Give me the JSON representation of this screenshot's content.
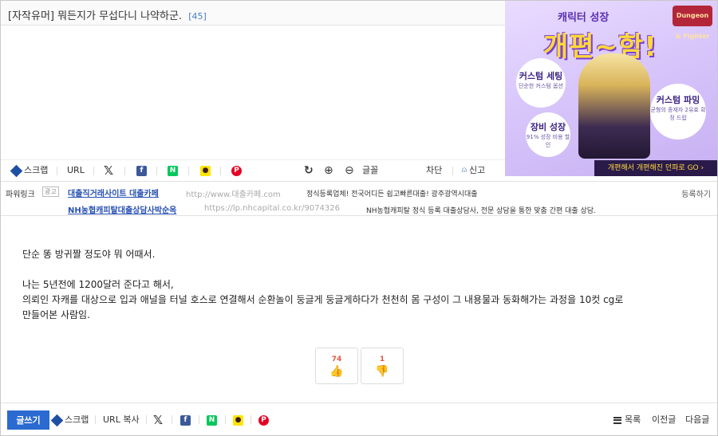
{
  "post": {
    "category": "[자작유머]",
    "title": "뭐든지가 무섭다니 나약하군.",
    "comment_count": "[45]"
  },
  "ad_banner": {
    "headline_top": "캐릭터 성장",
    "headline_main": "개편~함!",
    "logo_text": "Dungeon & Fighter",
    "bubble1_title": "커스텀 세팅",
    "bubble1_sub": "단순한 커스텀 옵션",
    "bubble2_title": "장비 성장",
    "bubble2_sub": "91% 성장 비용 할인",
    "bubble3_title": "커스텀 파밍",
    "bubble3_sub": "균형의 종재자 2유효 확정 드랍",
    "bottom_text": "개편해서 개편해진 던파로 GO ›"
  },
  "toolbar": {
    "scrap": "스크랩",
    "url": "URL",
    "x_icon": "𝕏",
    "facebook_icon": "f",
    "naver_icon": "N",
    "kakao_icon": "●",
    "pinterest_icon": "P",
    "refresh_icon": "↻",
    "zoom_in_icon": "⊕",
    "zoom_out_icon": "⊖",
    "font": "글꼴",
    "block": "차단",
    "report": "신고"
  },
  "powerlink": {
    "label": "파워링크",
    "ad_tag": "광고",
    "register": "등록하기",
    "ads": [
      {
        "title": "대출직거래사이트 대출카페",
        "url": "http://www.대출카페.com",
        "desc": "정식등록업체! 전국어디든 쉽고빠른대출! 광주광역시대출"
      },
      {
        "title": "NH농협캐피탈대출상담사박순옥",
        "url": "https://lp.nhcapital.co.kr/9074326",
        "desc": "NH농협캐피탈 정식 등록 대출상담사, 전문 상담을 통한 맞춤 간편 대출 상담."
      }
    ]
  },
  "content": {
    "lines": [
      "단순 똥 방귀짤 정도야 뭐 어때서.",
      "",
      "나는 5년전에 1200달러 준다고 해서,",
      "의뢰인 자캐를 대상으로 입과 애널을 터널 호스로 연결해서 순환놀이 둥글게 둥글게하다가 천천히 몸 구성이 그 내용물과 동화해가는 과정을 10컷 cg로",
      "만들어본 사람임."
    ]
  },
  "votes": {
    "up": "74",
    "down": "1",
    "up_icon": "👍",
    "down_icon": "👎"
  },
  "bottombar": {
    "write": "글쓰기",
    "scrap": "스크랩",
    "url_copy": "URL 복사",
    "x_icon": "𝕏",
    "facebook_icon": "f",
    "naver_icon": "N",
    "kakao_icon": "●",
    "pinterest_icon": "P",
    "list": "목록",
    "prev": "이전글",
    "next": "다음글"
  },
  "colors": {
    "accent": "#2a6ad1",
    "link": "#2952b3",
    "facebook": "#3b5998",
    "naver": "#03c75a",
    "kakao": "#fee500",
    "pinterest": "#e60023"
  }
}
